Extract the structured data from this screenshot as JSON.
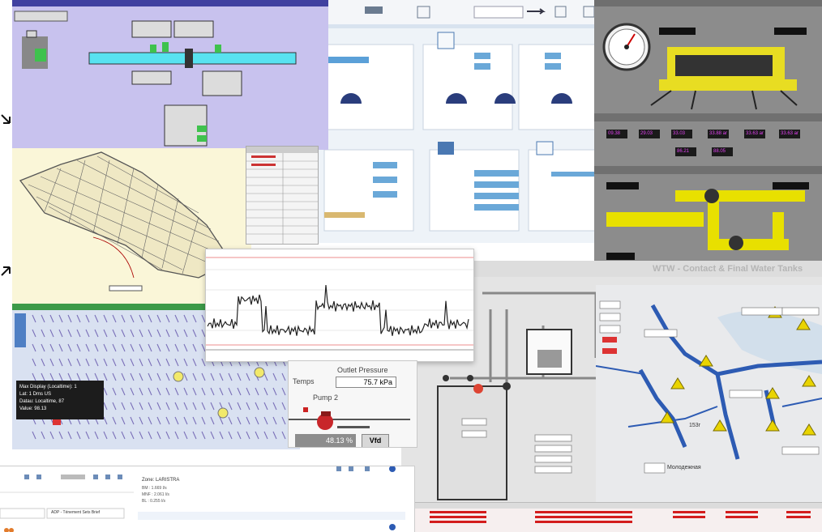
{
  "pump_panel": {
    "title": "Outlet Pressure",
    "pressure_value": "75.7 kPa",
    "temp_label": "Temps",
    "pump_name": "Pump 2",
    "speed_value": "48.13 %",
    "vfd_label": "Vfd"
  },
  "alarm_panel": {
    "zone": "Zone: LARISTRA",
    "lines": [
      "BM : 1.669 l/s",
      "MNF : 2.061 l/s",
      "BL : 0.255 l/s"
    ],
    "tab_label": "ADP - Ténement Sets Brief"
  },
  "tank_panel": {
    "title": "WTW - Contact & Final Water Tanks"
  },
  "map_popup": {
    "lines": [
      "Max Display (Localtime): 1",
      "Lat: 1 Dms US",
      "Datau: Localtime, 87",
      "Value: 98.13"
    ]
  },
  "gas_panel": {
    "values": [
      "09.38",
      "29.03",
      "33.03",
      "33.88 ar",
      "33.63 ar",
      "33.63 ar",
      "86.21",
      "88.05"
    ]
  },
  "network_map": {
    "label_a": "153г",
    "label_b": "Молодежная"
  },
  "colors": {
    "lavender": "#c8c2ee",
    "pipe_cyan": "#58e2f0",
    "gas_grey": "#8a8a8a",
    "gas_yellow": "#e8e000",
    "map_blue": "#2d5bb3",
    "alarm_red": "#d31d1d"
  }
}
